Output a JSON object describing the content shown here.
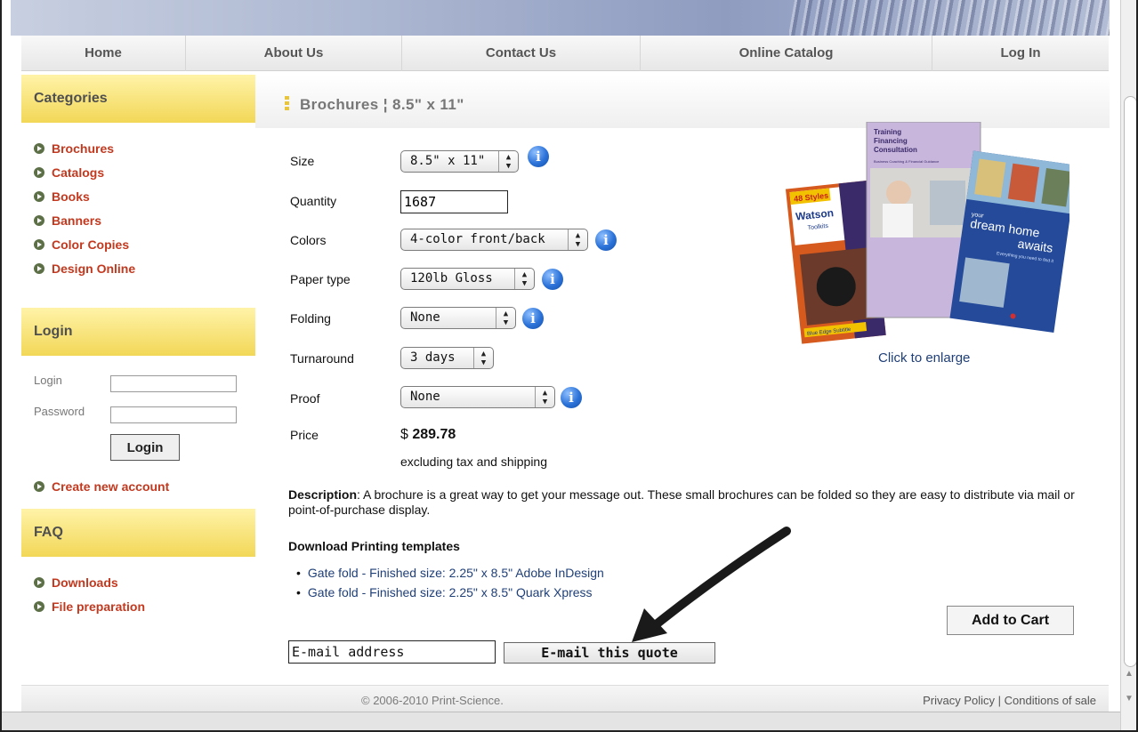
{
  "nav": {
    "items": [
      "Home",
      "About Us",
      "Contact Us",
      "Online Catalog",
      "Log In"
    ]
  },
  "sidebar": {
    "categories_title": "Categories",
    "categories": [
      "Brochures",
      "Catalogs",
      "Books",
      "Banners",
      "Color Copies",
      "Design Online"
    ],
    "login_title": "Login",
    "login_label": "Login",
    "password_label": "Password",
    "login_button": "Login",
    "create_account": "Create new account",
    "faq_title": "FAQ",
    "faq_items": [
      "Downloads",
      "File preparation"
    ]
  },
  "product": {
    "title": "Brochures ¦ 8.5\" x 11\"",
    "size_label": "Size",
    "size_value": "8.5\" x 11\"",
    "quantity_label": "Quantity",
    "quantity_value": "1687",
    "colors_label": "Colors",
    "colors_value": "4-color front/back",
    "paper_label": "Paper type",
    "paper_value": "120lb Gloss",
    "folding_label": "Folding",
    "folding_value": "None",
    "turnaround_label": "Turnaround",
    "turnaround_value": "3 days",
    "proof_label": "Proof",
    "proof_value": "None",
    "price_label": "Price",
    "price_currency": "$",
    "price_value": "289.78",
    "price_note": "excluding tax and shipping",
    "description_label": "Description",
    "description_text": ": A brochure is a great way to get your message out. These small brochures can be folded so they are easy to distribute via mail or point-of-purchase display.",
    "downloads_title": "Download Printing templates",
    "downloads": [
      "Gate fold - Finished size: 2.25\" x 8.5\" Adobe InDesign",
      "Gate fold - Finished size: 2.25\" x 8.5\" Quark Xpress"
    ],
    "enlarge_link": "Click to enlarge",
    "add_to_cart": "Add to Cart",
    "email_placeholder": "E-mail address",
    "email_button": "E-mail this quote"
  },
  "thumbnail": {
    "card1_top": "48 Styles",
    "card1_name": "Watson",
    "card1_sub": "Toolkits",
    "card1_bottom": "Blue Edge Subtitle",
    "card2_title_1": "Training",
    "card2_title_2": "Financing",
    "card2_title_3": "Consultation",
    "card2_sub": "Business Coaching & Financial Guidance",
    "card3_line1": "your",
    "card3_line2": "dream home",
    "card3_line3": "awaits",
    "card3_sub": "Everything you need to find it"
  },
  "footer": {
    "copyright": "© 2006-2010 Print-Science.",
    "privacy": "Privacy Policy",
    "separator": " | ",
    "conditions": "Conditions of sale"
  },
  "info_glyph": "i",
  "colors": {
    "accent_red": "#c2391f",
    "link_blue": "#1f3f78",
    "header_yellow": "#f2d757",
    "info_blue": "#2b72d8"
  }
}
